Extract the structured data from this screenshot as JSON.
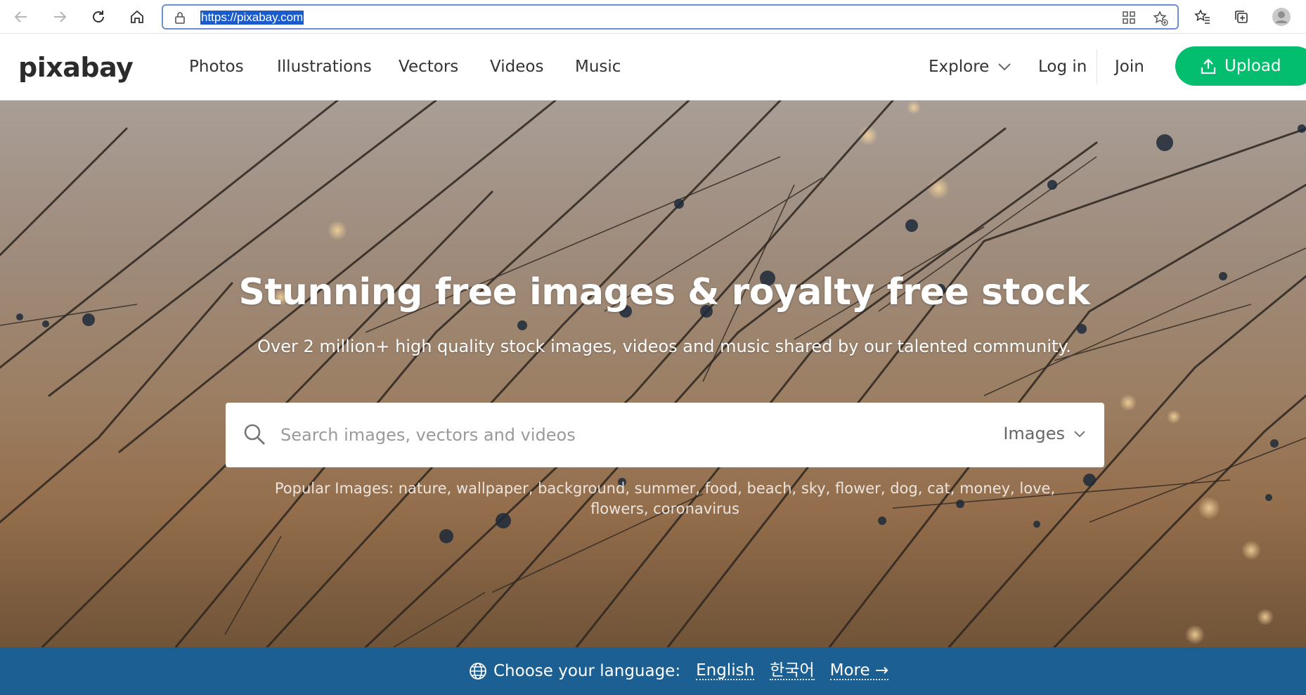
{
  "browser": {
    "url": "https://pixabay.com"
  },
  "header": {
    "logo": "pixabay",
    "nav": [
      "Photos",
      "Illustrations",
      "Vectors",
      "Videos",
      "Music"
    ],
    "explore": "Explore",
    "login": "Log in",
    "join": "Join",
    "upload": "Upload"
  },
  "hero": {
    "title": "Stunning free images & royalty free stock",
    "subtitle": "Over 2 million+ high quality stock images, videos and music shared by our talented community.",
    "search_placeholder": "Search images, vectors and videos",
    "search_type": "Images",
    "popular_label": "Popular Images:",
    "popular_tags": [
      "nature",
      "wallpaper",
      "background",
      "summer",
      "food",
      "beach",
      "sky",
      "flower",
      "dog",
      "cat",
      "money",
      "love",
      "flowers",
      "coronavirus"
    ]
  },
  "language_bar": {
    "label": "Choose your language:",
    "options": [
      "English",
      "한국어"
    ],
    "more": "More →"
  },
  "colors": {
    "upload_green": "#02be6e",
    "language_bar_blue": "#1c5f92",
    "url_highlight": "#1a5ccc"
  }
}
